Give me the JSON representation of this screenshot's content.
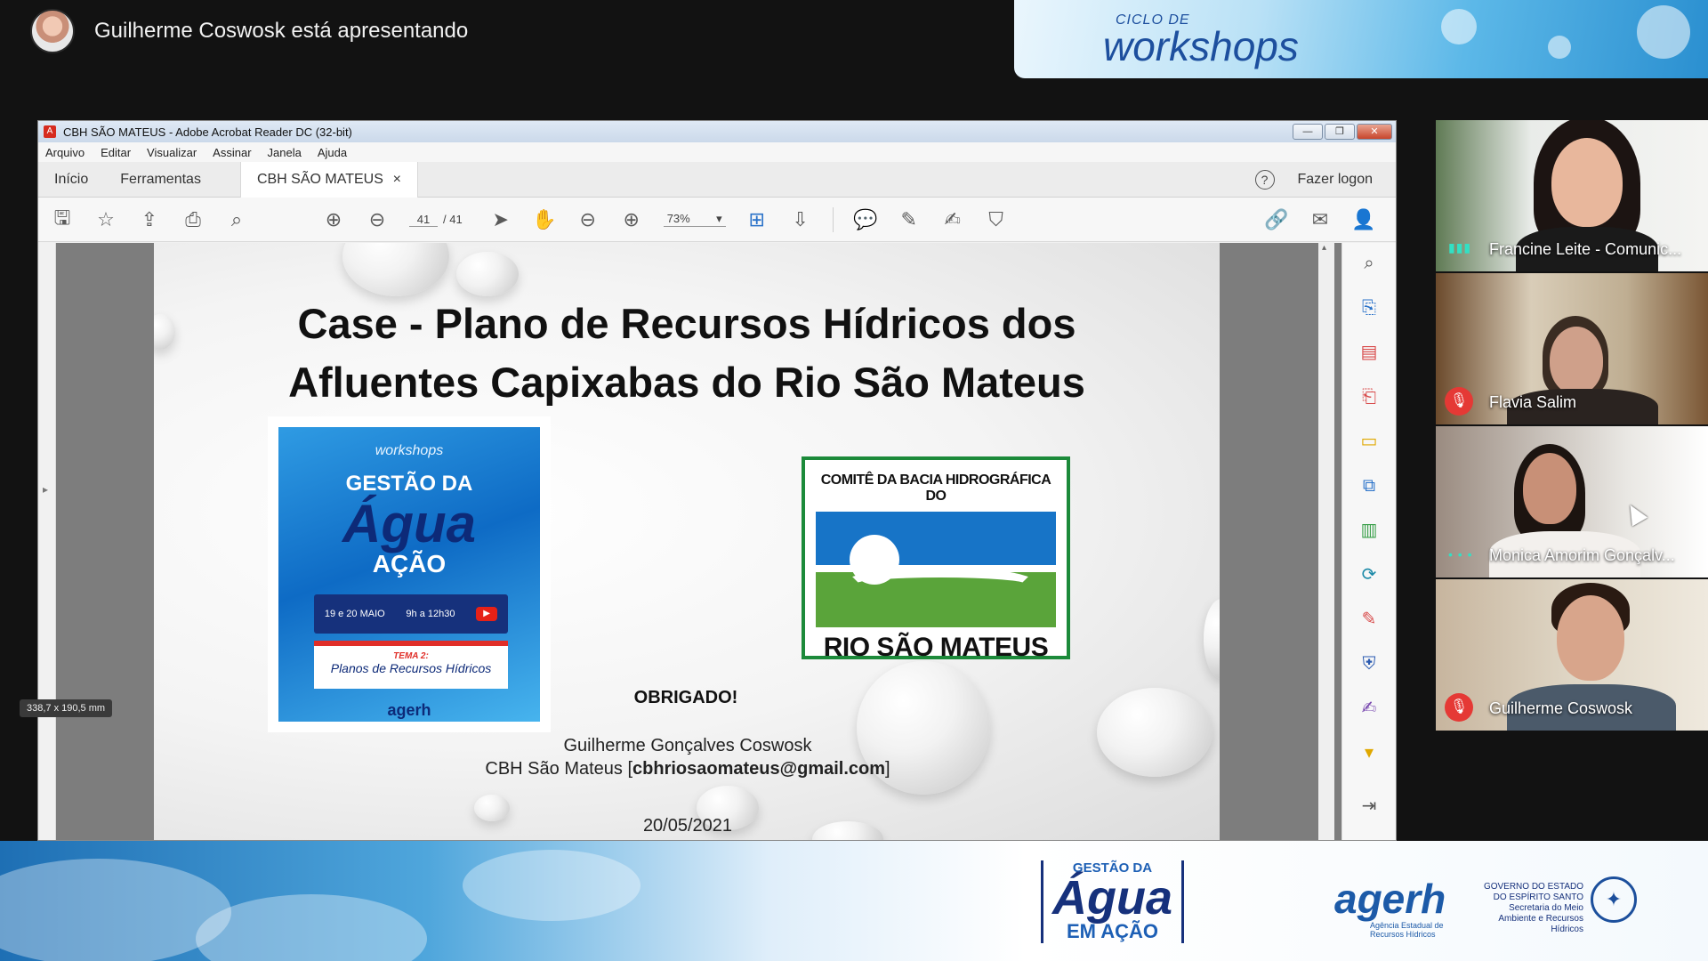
{
  "presenter": {
    "status": "Guilherme Coswosk está apresentando"
  },
  "top_banner": {
    "small": "CICLO DE",
    "big": "workshops"
  },
  "acrobat": {
    "title": "CBH SÃO MATEUS - Adobe Acrobat Reader DC (32-bit)",
    "menu": [
      "Arquivo",
      "Editar",
      "Visualizar",
      "Assinar",
      "Janela",
      "Ajuda"
    ],
    "tabs": {
      "home": "Início",
      "tools": "Ferramentas",
      "doc": "CBH SÃO MATEUS",
      "close": "×"
    },
    "login": "Fazer logon",
    "help": "?",
    "page_current": "41",
    "page_total": "/ 41",
    "zoom": "73%",
    "dims": "338,7 x 190,5 mm"
  },
  "slide": {
    "title_line1": "Case - Plano de Recursos Hídricos dos",
    "title_line2": "Afluentes Capixabas do Rio São Mateus",
    "poster": {
      "small": "workshops",
      "gestao": "GESTÃO DA",
      "agua": "Água",
      "acao": "AÇÃO",
      "dates": "19 e 20 MAIO",
      "time": "9h a 12h30",
      "tema_label": "TEMA 2:",
      "tema": "Planos de Recursos Hídricos",
      "agerh": "agerh"
    },
    "logo": {
      "top": "COMITÊ DA BACIA HIDROGRÁFICA DO",
      "bottom": "RIO SÃO MATEUS"
    },
    "thanks": "OBRIGADO!",
    "author": "Guilherme Gonçalves Coswosk",
    "org": "CBH São Mateus [",
    "email": "cbhriosaomateus@gmail.com",
    "org_end": "]",
    "date": "20/05/2021"
  },
  "participants": [
    {
      "name": "Francine Leite - Comunic...",
      "muted": false,
      "talking": true
    },
    {
      "name": "Flavia Salim",
      "muted": true,
      "talking": false
    },
    {
      "name": "Monica Amorim Gonçalv...",
      "muted": false,
      "talking": true
    },
    {
      "name": "Guilherme Coswosk",
      "muted": true,
      "talking": false
    }
  ],
  "bottom_banner": {
    "gestao": "GESTÃO DA",
    "agua": "Água",
    "acao": "EM AÇÃO",
    "agerh": "agerh",
    "agerh_sub": "Agência Estadual de Recursos Hídricos",
    "gov": "GOVERNO DO ESTADO DO ESPÍRITO SANTO Secretaria do Meio Ambiente e Recursos Hídricos"
  },
  "colors": {
    "accent_blue": "#1774c7",
    "green": "#5aa43a",
    "mute_red": "#e53935"
  }
}
